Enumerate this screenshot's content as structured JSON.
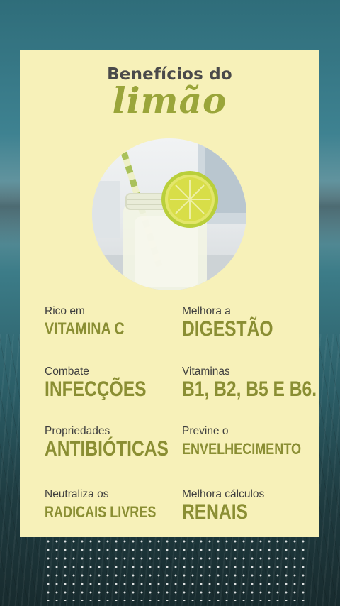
{
  "header": {
    "title_line1": "Benefícios do",
    "title_line2": "limão"
  },
  "colors": {
    "card_background": "#f7f1b9",
    "accent_green": "#8a8e33",
    "script_green": "#9aa53a",
    "label_text": "#3f3f3f"
  },
  "image": {
    "subject": "lemon-water-jar-with-straw-and-lemon-slice"
  },
  "benefits": [
    {
      "label": "Rico em",
      "value": "VITAMINA C"
    },
    {
      "label": "Melhora a",
      "value": "DIGESTÃO"
    },
    {
      "label": "Combate",
      "value": "INFECÇÕES"
    },
    {
      "label": "Vitaminas",
      "value": "B1, B2, B5 E B6."
    },
    {
      "label": "Propriedades",
      "value": "ANTIBIÓTICAS"
    },
    {
      "label": "Previne o",
      "value": "ENVELHECIMENTO"
    },
    {
      "label": "Neutraliza os",
      "value": "RADICAIS LIVRES"
    },
    {
      "label": "Melhora cálculos",
      "value": "RENAIS"
    }
  ]
}
